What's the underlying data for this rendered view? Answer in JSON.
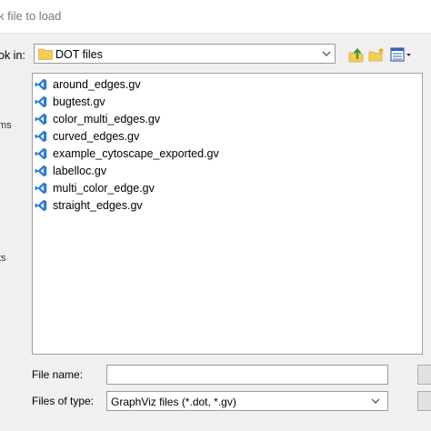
{
  "window": {
    "title": "k file to load"
  },
  "lookin": {
    "label": "ok in:",
    "value": "DOT files"
  },
  "places": [
    {
      "label": "ms"
    },
    {
      "label": "ts"
    }
  ],
  "files": [
    {
      "name": "around_edges.gv"
    },
    {
      "name": "bugtest.gv"
    },
    {
      "name": "color_multi_edges.gv"
    },
    {
      "name": "curved_edges.gv"
    },
    {
      "name": "example_cytoscape_exported.gv"
    },
    {
      "name": "labelloc.gv"
    },
    {
      "name": "multi_color_edge.gv"
    },
    {
      "name": "straight_edges.gv"
    }
  ],
  "filename": {
    "label": "File name:",
    "value": "",
    "placeholder": ""
  },
  "filetype": {
    "label": "Files of type:",
    "value": "GraphViz files (*.dot, *.gv)"
  },
  "icons": {
    "folder": "folder-icon",
    "file": "vscode-icon",
    "up": "up-folder-icon",
    "new_folder": "new-folder-icon",
    "view": "view-menu-icon"
  },
  "colors": {
    "vscode_blue": "#2b7bd6",
    "folder_yellow": "#f2cd58"
  }
}
